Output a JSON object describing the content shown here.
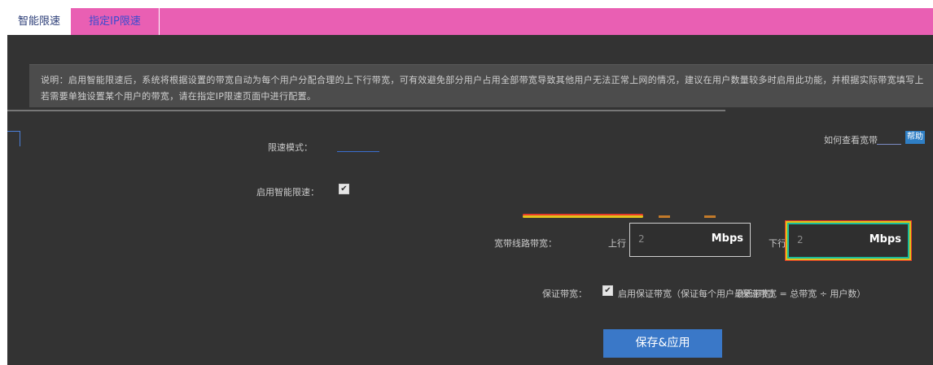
{
  "tabs": [
    {
      "label": "智能限速"
    },
    {
      "label": "指定IP限速"
    }
  ],
  "notice": {
    "line1": "说明：启用智能限速后，系统将根据设置的带宽自动为每个用户分配合理的上下行带宽，可有效避免部分用户占用全部带宽导致其他用户无法正常上网的情况，建议在用户数量较多时启用此功能，并根据实际带宽填写上下行速率值。",
    "line2": "若需要单独设置某个用户的带宽，请在指定IP限速页面中进行配置。"
  },
  "form": {
    "mode_label": "限速模式：",
    "mode_value": "",
    "enable_label": "启用智能限速：",
    "enable_checked": "✔",
    "bandwidth_label": "宽带线路带宽：",
    "upload_prefix": "上行",
    "download_prefix": "下行",
    "upload_value": "2",
    "download_value": "2",
    "unit": "Mbps",
    "guarantee_label": "保证带宽：",
    "guarantee_checked": "✔",
    "guarantee_text": "启用保证带宽（保证每个用户最低带宽）",
    "guarantee_extra": "（保证带宽 = 总带宽 ÷ 用户数）",
    "right_link": "如何查看宽带",
    "badge": "帮助",
    "save_label": "保存&应用"
  }
}
